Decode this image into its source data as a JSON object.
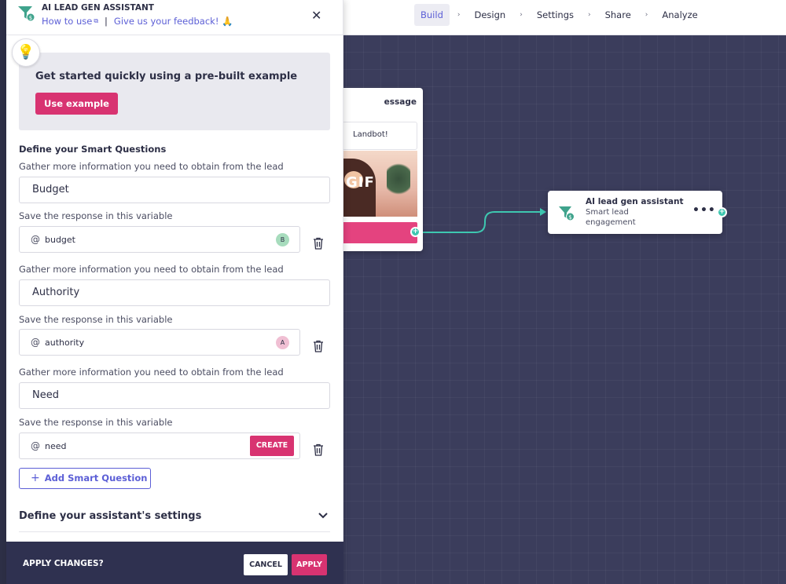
{
  "nav": {
    "items": [
      "Build",
      "Design",
      "Settings",
      "Share",
      "Analyze"
    ],
    "separator": "›",
    "active": "Build"
  },
  "canvas": {
    "message_node": {
      "title_partial": "essage",
      "bubble_text": "Landbot!",
      "gif_label": "GIF"
    },
    "ai_node": {
      "title": "AI lead gen assistant",
      "subtitle": "Smart lead engagement",
      "more": "•••"
    },
    "port_symbol": "+"
  },
  "panel": {
    "title": "AI LEAD GEN ASSISTANT",
    "how_to_use": "How to use",
    "feedback": "Give us your feedback! 🙏",
    "link_separator": "|",
    "close": "✕",
    "bulb_icon": "💡",
    "example": {
      "title": "Get started quickly using a pre-built example",
      "button": "Use example"
    },
    "section_title": "Define your Smart Questions",
    "questions": [
      {
        "gather_label": "Gather more information you need to obtain from the lead",
        "value": "Budget",
        "save_label": "Save the response in this variable",
        "variable": "budget",
        "badge": "B",
        "badge_color": "#a7dcbd"
      },
      {
        "gather_label": "Gather more information you need to obtain from the lead",
        "value": "Authority",
        "save_label": "Save the response in this variable",
        "variable": "authority",
        "badge": "A",
        "badge_color": "#f0bfd3"
      },
      {
        "gather_label": "Gather more information you need to obtain from the lead",
        "value": "Need",
        "save_label": "Save the response in this variable",
        "variable": "need",
        "create": "CREATE"
      }
    ],
    "add_question": "Add Smart Question",
    "add_plus": "+",
    "settings_title": "Define your assistant's settings"
  },
  "footer": {
    "title": "APPLY CHANGES?",
    "cancel": "CANCEL",
    "apply": "APPLY"
  },
  "colors": {
    "accent": "#5c5fd6",
    "brand_pink": "#d83371",
    "teal": "#3ec7b0",
    "canvas": "#3b3d5c"
  },
  "icons": [
    "funnel-dollar-icon",
    "external-link-icon",
    "close-icon",
    "lightbulb-icon",
    "trash-icon",
    "chevron-down-icon",
    "more-icon",
    "plus-icon"
  ]
}
